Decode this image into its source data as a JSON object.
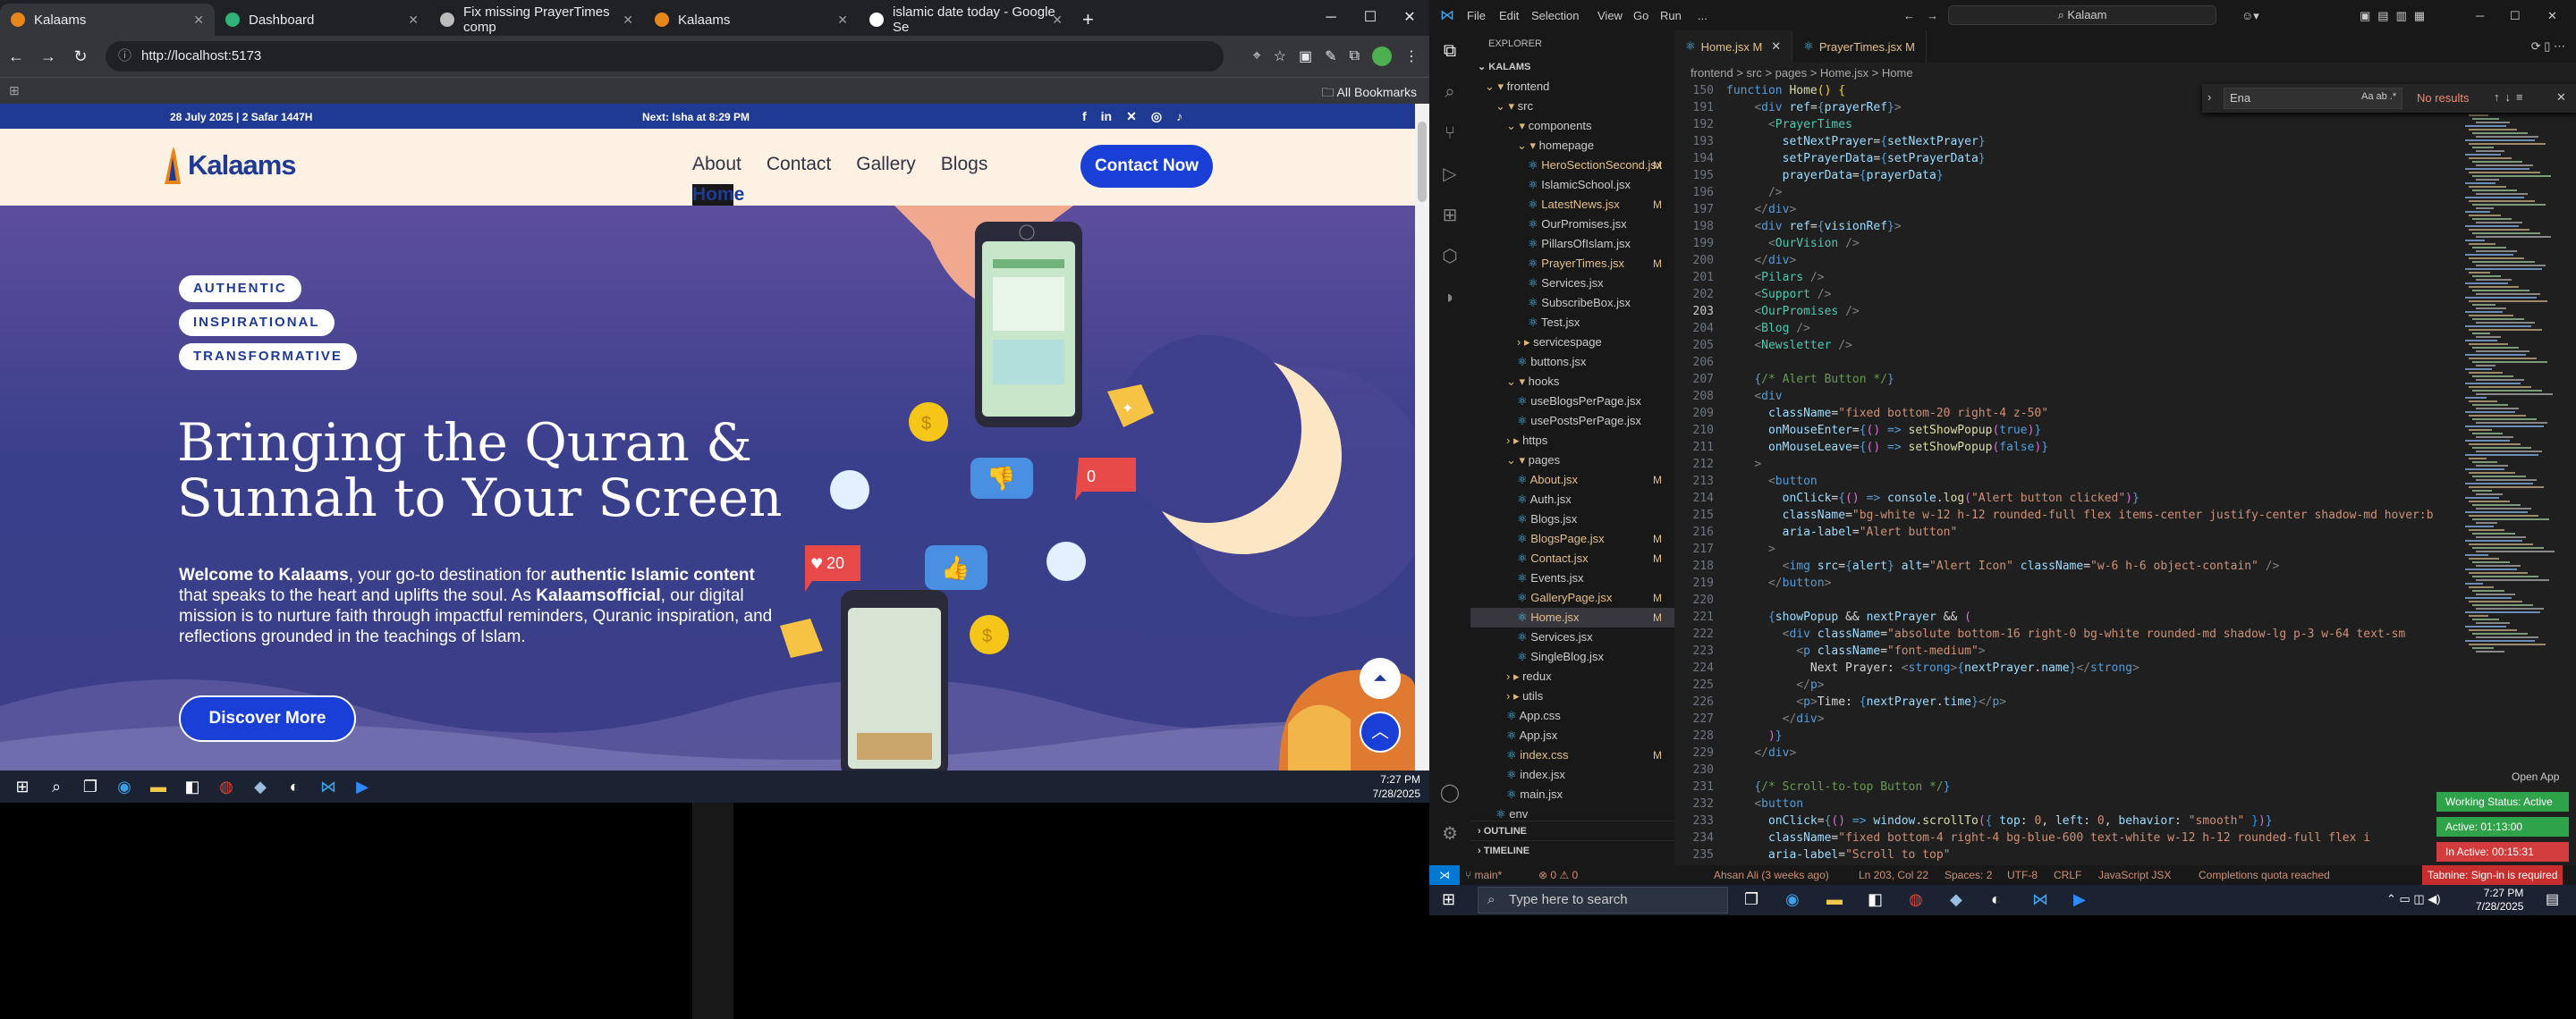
{
  "browser": {
    "tabs": [
      {
        "label": "Kalaams",
        "color": "#e8861a"
      },
      {
        "label": "Dashboard",
        "color": "#2fb37a"
      },
      {
        "label": "Fix missing PrayerTimes comp",
        "color": "#bbbbbb"
      },
      {
        "label": "Kalaams",
        "color": "#e8861a"
      },
      {
        "label": "islamic date today - Google Se",
        "color": "#ffffff"
      }
    ],
    "url": "http://localhost:5173",
    "all_bookmarks": "All Bookmarks"
  },
  "site": {
    "date": "28 July 2025 | 2 Safar 1447H",
    "next_prayer": "Next: Isha at 8:29 PM",
    "logo": "Kalaams",
    "nav": [
      "Home",
      "About",
      "Contact",
      "Gallery",
      "Blogs"
    ],
    "contact_button": "Contact Now",
    "pills": [
      "AUTHENTIC",
      "INSPIRATIONAL",
      "TRANSFORMATIVE"
    ],
    "headline_1": "Bringing the Quran &",
    "headline_2": "Sunnah to Your Screen",
    "desc_1": "Welcome to Kalaams",
    "desc_2": ", your go-to destination for ",
    "desc_3": "authentic Islamic content",
    "desc_4": " that speaks to the heart and uplifts the soul. As ",
    "desc_5": "Kalaamsofficial",
    "desc_6": ", our digital mission is to nurture faith through impactful reminders, Quranic inspiration, and reflections grounded in the teachings of Islam.",
    "discover_button": "Discover More",
    "heart_count": "20",
    "bubble_count": "0"
  },
  "taskbar_left": {
    "time": "7:27 PM",
    "date": "7/28/2025"
  },
  "vscode": {
    "menu": [
      "File",
      "Edit",
      "Selection",
      "View",
      "Go",
      "Run",
      "..."
    ],
    "search": "Kalaam",
    "explorer_title": "EXPLORER",
    "root": "KALAMS",
    "tree": [
      {
        "name": "frontend",
        "indent": 1,
        "type": "folder-open",
        "status": ""
      },
      {
        "name": "src",
        "indent": 2,
        "type": "folder-open",
        "status": ""
      },
      {
        "name": "components",
        "indent": 3,
        "type": "folder-open",
        "status": ""
      },
      {
        "name": "homepage",
        "indent": 4,
        "type": "folder-open",
        "status": ""
      },
      {
        "name": "HeroSectionSecond.jsx",
        "indent": 5,
        "type": "file",
        "status": "M"
      },
      {
        "name": "IslamicSchool.jsx",
        "indent": 5,
        "type": "file",
        "status": ""
      },
      {
        "name": "LatestNews.jsx",
        "indent": 5,
        "type": "file",
        "status": "M"
      },
      {
        "name": "OurPromises.jsx",
        "indent": 5,
        "type": "file",
        "status": ""
      },
      {
        "name": "PillarsOfIslam.jsx",
        "indent": 5,
        "type": "file",
        "status": ""
      },
      {
        "name": "PrayerTimes.jsx",
        "indent": 5,
        "type": "file",
        "status": "M"
      },
      {
        "name": "Services.jsx",
        "indent": 5,
        "type": "file",
        "status": ""
      },
      {
        "name": "SubscribeBox.jsx",
        "indent": 5,
        "type": "file",
        "status": ""
      },
      {
        "name": "Test.jsx",
        "indent": 5,
        "type": "file",
        "status": ""
      },
      {
        "name": "servicespage",
        "indent": 4,
        "type": "folder",
        "status": ""
      },
      {
        "name": "buttons.jsx",
        "indent": 4,
        "type": "file",
        "status": ""
      },
      {
        "name": "hooks",
        "indent": 3,
        "type": "folder-open",
        "status": ""
      },
      {
        "name": "useBlogsPerPage.jsx",
        "indent": 4,
        "type": "file",
        "status": ""
      },
      {
        "name": "usePostsPerPage.jsx",
        "indent": 4,
        "type": "file",
        "status": ""
      },
      {
        "name": "https",
        "indent": 3,
        "type": "folder",
        "status": ""
      },
      {
        "name": "pages",
        "indent": 3,
        "type": "folder-open",
        "status": ""
      },
      {
        "name": "About.jsx",
        "indent": 4,
        "type": "file",
        "status": "M"
      },
      {
        "name": "Auth.jsx",
        "indent": 4,
        "type": "file",
        "status": ""
      },
      {
        "name": "Blogs.jsx",
        "indent": 4,
        "type": "file",
        "status": ""
      },
      {
        "name": "BlogsPage.jsx",
        "indent": 4,
        "type": "file",
        "status": "M"
      },
      {
        "name": "Contact.jsx",
        "indent": 4,
        "type": "file",
        "status": "M"
      },
      {
        "name": "Events.jsx",
        "indent": 4,
        "type": "file",
        "status": ""
      },
      {
        "name": "GalleryPage.jsx",
        "indent": 4,
        "type": "file",
        "status": "M"
      },
      {
        "name": "Home.jsx",
        "indent": 4,
        "type": "file",
        "status": "M",
        "selected": true
      },
      {
        "name": "Services.jsx",
        "indent": 4,
        "type": "file",
        "status": ""
      },
      {
        "name": "SingleBlog.jsx",
        "indent": 4,
        "type": "file",
        "status": ""
      },
      {
        "name": "redux",
        "indent": 3,
        "type": "folder",
        "status": ""
      },
      {
        "name": "utils",
        "indent": 3,
        "type": "folder",
        "status": ""
      },
      {
        "name": "App.css",
        "indent": 3,
        "type": "file",
        "status": ""
      },
      {
        "name": "App.jsx",
        "indent": 3,
        "type": "file",
        "status": ""
      },
      {
        "name": "index.css",
        "indent": 3,
        "type": "file",
        "status": "M"
      },
      {
        "name": "index.jsx",
        "indent": 3,
        "type": "file",
        "status": ""
      },
      {
        "name": "main.jsx",
        "indent": 3,
        "type": "file",
        "status": ""
      },
      {
        "name": "env",
        "indent": 2,
        "type": "file",
        "status": ""
      }
    ],
    "outline": "OUTLINE",
    "timeline": "TIMELINE",
    "editor_tabs": [
      {
        "label": "Home.jsx M",
        "active": true
      },
      {
        "label": "PrayerTimes.jsx M",
        "active": false
      }
    ],
    "breadcrumb": "frontend > src > pages > Home.jsx > Home",
    "find_value": "Ena",
    "find_result": "No results",
    "code_lines": [
      {
        "no": "150",
        "html": "<span class='k'>function</span> <span class='f'>Home</span><span class='y'>()</span> <span class='y'>{</span>"
      },
      {
        "no": "191",
        "html": "    <span class='g'>&lt;</span><span class='k'>div</span> <span class='v'>ref</span><span class='p'>=</span><span class='k'>{</span><span class='v'>prayerRef</span><span class='k'>}</span><span class='g'>&gt;</span>"
      },
      {
        "no": "192",
        "html": "      <span class='g'>&lt;</span><span class='t'>PrayerTimes</span>"
      },
      {
        "no": "193",
        "html": "        <span class='v'>setNextPrayer</span><span class='p'>=</span><span class='k'>{</span><span class='v'>setNextPrayer</span><span class='k'>}</span>"
      },
      {
        "no": "194",
        "html": "        <span class='v'>setPrayerData</span><span class='p'>=</span><span class='k'>{</span><span class='v'>setPrayerData</span><span class='k'>}</span>"
      },
      {
        "no": "195",
        "html": "        <span class='v'>prayerData</span><span class='p'>=</span><span class='k'>{</span><span class='v'>prayerData</span><span class='k'>}</span>"
      },
      {
        "no": "196",
        "html": "      <span class='g'>/&gt;</span>"
      },
      {
        "no": "197",
        "html": "    <span class='g'>&lt;/</span><span class='k'>div</span><span class='g'>&gt;</span>"
      },
      {
        "no": "198",
        "html": "    <span class='g'>&lt;</span><span class='k'>div</span> <span class='v'>ref</span><span class='p'>=</span><span class='k'>{</span><span class='v'>visionRef</span><span class='k'>}</span><span class='g'>&gt;</span>"
      },
      {
        "no": "199",
        "html": "      <span class='g'>&lt;</span><span class='t'>OurVision</span> <span class='g'>/&gt;</span>"
      },
      {
        "no": "200",
        "html": "    <span class='g'>&lt;/</span><span class='k'>div</span><span class='g'>&gt;</span>"
      },
      {
        "no": "201",
        "html": "    <span class='g'>&lt;</span><span class='t'>Pilars</span> <span class='g'>/&gt;</span>"
      },
      {
        "no": "202",
        "html": "    <span class='g'>&lt;</span><span class='t'>Support</span> <span class='g'>/&gt;</span>"
      },
      {
        "no": "203",
        "html": "    <span class='g'>&lt;</span><span class='t'>OurPromises</span> <span class='g'>/&gt;</span>",
        "cur": true
      },
      {
        "no": "204",
        "html": "    <span class='g'>&lt;</span><span class='t'>Blog</span> <span class='g'>/&gt;</span>"
      },
      {
        "no": "205",
        "html": "    <span class='g'>&lt;</span><span class='t'>Newsletter</span> <span class='g'>/&gt;</span>"
      },
      {
        "no": "206",
        "html": ""
      },
      {
        "no": "207",
        "html": "    <span class='k'>{</span><span class='c'>/* Alert Button */</span><span class='k'>}</span>"
      },
      {
        "no": "208",
        "html": "    <span class='g'>&lt;</span><span class='k'>div</span>"
      },
      {
        "no": "209",
        "html": "      <span class='v'>className</span><span class='p'>=</span><span class='s'>\"fixed bottom-20 right-4 z-50\"</span>"
      },
      {
        "no": "210",
        "html": "      <span class='v'>onMouseEnter</span><span class='p'>=</span><span class='k'>{</span><span class='pu'>()</span> <span class='k'>=&gt;</span> <span class='f'>setShowPopup</span><span class='pu'>(</span><span class='k'>true</span><span class='pu'>)</span><span class='k'>}</span>"
      },
      {
        "no": "211",
        "html": "      <span class='v'>onMouseLeave</span><span class='p'>=</span><span class='k'>{</span><span class='pu'>()</span> <span class='k'>=&gt;</span> <span class='f'>setShowPopup</span><span class='pu'>(</span><span class='k'>false</span><span class='pu'>)</span><span class='k'>}</span>"
      },
      {
        "no": "212",
        "html": "    <span class='g'>&gt;</span>"
      },
      {
        "no": "213",
        "html": "      <span class='g'>&lt;</span><span class='k'>button</span>"
      },
      {
        "no": "214",
        "html": "        <span class='v'>onClick</span><span class='p'>=</span><span class='k'>{</span><span class='pu'>()</span> <span class='k'>=&gt;</span> <span class='v'>console</span><span class='p'>.</span><span class='f'>log</span><span class='pu'>(</span><span class='s'>\"Alert button clicked\"</span><span class='pu'>)</span><span class='k'>}</span>"
      },
      {
        "no": "215",
        "html": "        <span class='v'>className</span><span class='p'>=</span><span class='s'>\"bg-white w-12 h-12 rounded-full flex items-center justify-center shadow-md hover:b</span>"
      },
      {
        "no": "216",
        "html": "        <span class='v'>aria-label</span><span class='p'>=</span><span class='s'>\"Alert button\"</span>"
      },
      {
        "no": "217",
        "html": "      <span class='g'>&gt;</span>"
      },
      {
        "no": "218",
        "html": "        <span class='g'>&lt;</span><span class='k'>img</span> <span class='v'>src</span><span class='p'>=</span><span class='k'>{</span><span class='v'>alert</span><span class='k'>}</span> <span class='v'>alt</span><span class='p'>=</span><span class='s'>\"Alert Icon\"</span> <span class='v'>className</span><span class='p'>=</span><span class='s'>\"w-6 h-6 object-contain\"</span> <span class='g'>/&gt;</span>"
      },
      {
        "no": "219",
        "html": "      <span class='g'>&lt;/</span><span class='k'>button</span><span class='g'>&gt;</span>"
      },
      {
        "no": "220",
        "html": ""
      },
      {
        "no": "221",
        "html": "      <span class='k'>{</span><span class='v'>showPopup</span> <span class='p'>&amp;&amp;</span> <span class='v'>nextPrayer</span> <span class='p'>&amp;&amp;</span> <span class='pu'>(</span>"
      },
      {
        "no": "222",
        "html": "        <span class='g'>&lt;</span><span class='k'>div</span> <span class='v'>className</span><span class='p'>=</span><span class='s'>\"absolute bottom-16 right-0 bg-white rounded-md shadow-lg p-3 w-64 text-sm </span>"
      },
      {
        "no": "223",
        "html": "          <span class='g'>&lt;</span><span class='k'>p</span> <span class='v'>className</span><span class='p'>=</span><span class='s'>\"font-medium\"</span><span class='g'>&gt;</span>"
      },
      {
        "no": "224",
        "html": "            <span class='p'>Next Prayer: </span><span class='g'>&lt;</span><span class='k'>strong</span><span class='g'>&gt;</span><span class='k'>{</span><span class='v'>nextPrayer</span><span class='p'>.</span><span class='v'>name</span><span class='k'>}</span><span class='g'>&lt;/</span><span class='k'>strong</span><span class='g'>&gt;</span>"
      },
      {
        "no": "225",
        "html": "          <span class='g'>&lt;/</span><span class='k'>p</span><span class='g'>&gt;</span>"
      },
      {
        "no": "226",
        "html": "          <span class='g'>&lt;</span><span class='k'>p</span><span class='g'>&gt;</span><span class='p'>Time: </span><span class='k'>{</span><span class='v'>nextPrayer</span><span class='p'>.</span><span class='v'>time</span><span class='k'>}</span><span class='g'>&lt;/</span><span class='k'>p</span><span class='g'>&gt;</span>"
      },
      {
        "no": "227",
        "html": "        <span class='g'>&lt;/</span><span class='k'>div</span><span class='g'>&gt;</span>"
      },
      {
        "no": "228",
        "html": "      <span class='pu'>)</span><span class='k'>}</span>"
      },
      {
        "no": "229",
        "html": "    <span class='g'>&lt;/</span><span class='k'>div</span><span class='g'>&gt;</span>"
      },
      {
        "no": "230",
        "html": ""
      },
      {
        "no": "231",
        "html": "    <span class='k'>{</span><span class='c'>/* Scroll-to-top Button */</span><span class='k'>}</span>"
      },
      {
        "no": "232",
        "html": "    <span class='g'>&lt;</span><span class='k'>button</span>"
      },
      {
        "no": "233",
        "html": "      <span class='v'>onClick</span><span class='p'>=</span><span class='k'>{</span><span class='pu'>()</span> <span class='k'>=&gt;</span> <span class='v'>window</span><span class='p'>.</span><span class='f'>scrollTo</span><span class='pu'>(</span><span class='b'>{</span> <span class='v'>top</span><span class='p'>: </span><span class='s'>0</span><span class='p'>, </span><span class='v'>left</span><span class='p'>: </span><span class='s'>0</span><span class='p'>, </span><span class='v'>behavior</span><span class='p'>: </span><span class='s'>\"smooth\"</span> <span class='b'>}</span><span class='pu'>)</span><span class='k'>}</span>"
      },
      {
        "no": "234",
        "html": "      <span class='v'>className</span><span class='p'>=</span><span class='s'>\"fixed bottom-4 right-4 bg-blue-600 text-white w-12 h-12 rounded-full flex i</span>"
      },
      {
        "no": "235",
        "html": "      <span class='v'>aria-label</span><span class='p'>=</span><span class='s'>\"Scroll to top\"</span>"
      }
    ],
    "status": {
      "branch": "main*",
      "problems": "⊗ 0 ⚠ 0",
      "author": "Ahsan Ali (3 weeks ago)",
      "position": "Ln 203, Col 22",
      "spaces": "Spaces: 2",
      "encoding": "UTF-8",
      "eol": "CRLF",
      "lang": "JavaScript JSX",
      "quota": "Completions quota reached",
      "tabnine": "Tabnine: Sign-in is required"
    },
    "open_app": "Open App",
    "working_status": "Working Status: Active",
    "active_time": "Active: 01:13:00",
    "inactive_time": "In Active: 00:15:31"
  },
  "taskbar_right": {
    "search_placeholder": "Type here to search",
    "time": "7:27 PM",
    "date": "7/28/2025"
  }
}
